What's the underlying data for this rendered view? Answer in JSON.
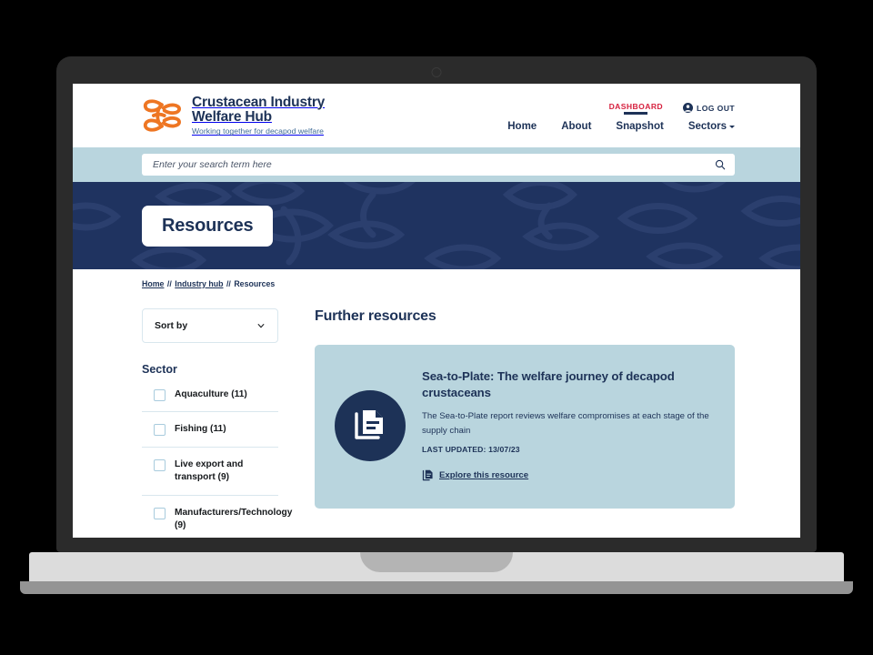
{
  "brand": {
    "line1": "Crustacean Industry",
    "line2": "Welfare Hub",
    "tagline": "Working together for decapod welfare",
    "logo_color": "#ee7623",
    "text_color": "#1d3257"
  },
  "header": {
    "dashboard_label": "DASHBOARD",
    "dashboard_color": "#d61f3d",
    "logout_label": "LOG OUT",
    "nav": [
      {
        "label": "Home"
      },
      {
        "label": "About"
      },
      {
        "label": "Snapshot"
      },
      {
        "label": "Sectors"
      }
    ]
  },
  "search": {
    "placeholder": "Enter your search term here",
    "value": "",
    "band_color": "#b9d5de"
  },
  "hero": {
    "title": "Resources",
    "background_color": "#1f3360"
  },
  "breadcrumb": {
    "items": [
      {
        "label": "Home",
        "link": true
      },
      {
        "label": "Industry hub",
        "link": true
      },
      {
        "label": "Resources",
        "link": false
      }
    ],
    "separator": "//"
  },
  "sidebar": {
    "sort_label": "Sort by",
    "sector_heading": "Sector",
    "facets": [
      {
        "label": "Aquaculture (11)",
        "checked": false
      },
      {
        "label": "Fishing (11)",
        "checked": false
      },
      {
        "label": "Live export and transport (9)",
        "checked": false
      },
      {
        "label": "Manufacturers/Technology (9)",
        "checked": false
      }
    ]
  },
  "main": {
    "heading": "Further resources",
    "cards": [
      {
        "title": "Sea-to-Plate: The welfare journey of decapod crustaceans",
        "description": "The Sea-to-Plate report reviews welfare compromises at each stage of the supply chain",
        "meta": "LAST UPDATED: 13/07/23",
        "link_label": "Explore this resource",
        "background_color": "#b9d5de",
        "icon": "document-stack-icon"
      }
    ]
  },
  "device": {
    "bezel_color": "#2b2b2b",
    "base_color": "#dcdcdc",
    "lip_color": "#949494"
  }
}
